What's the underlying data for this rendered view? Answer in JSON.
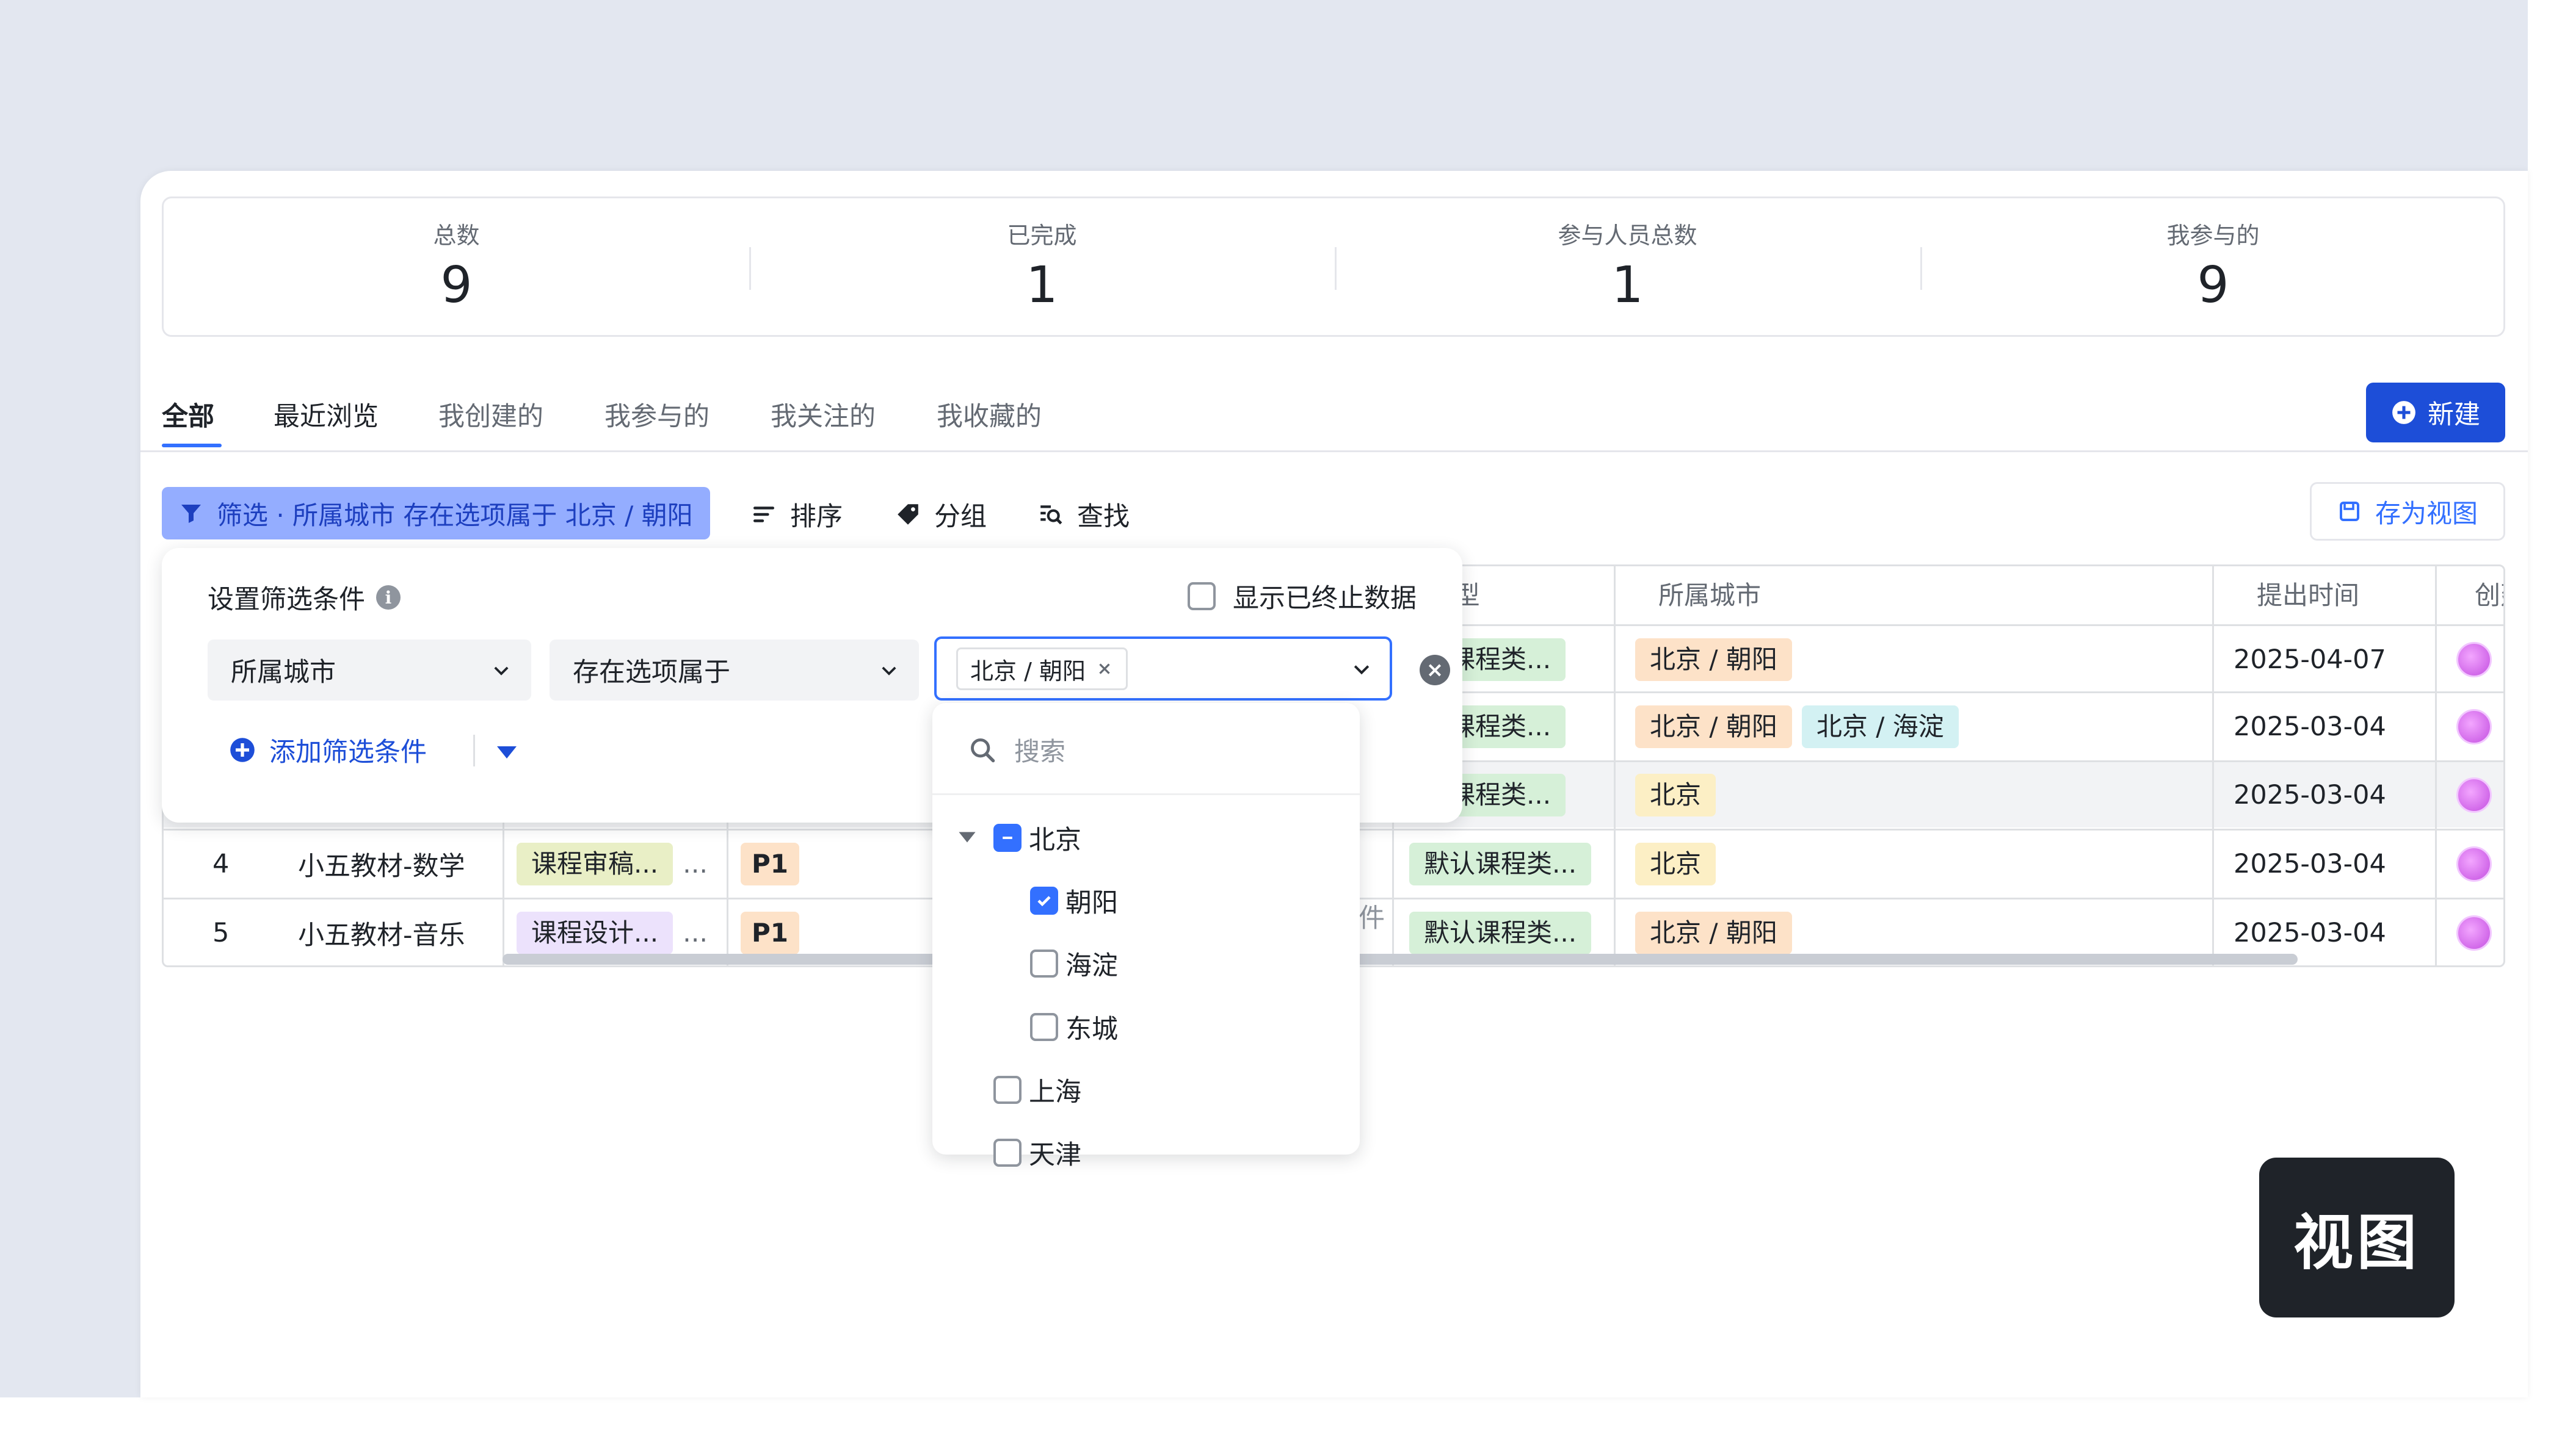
{
  "stats": [
    {
      "label": "总数",
      "value": "9"
    },
    {
      "label": "已完成",
      "value": "1"
    },
    {
      "label": "参与人员总数",
      "value": "1"
    },
    {
      "label": "我参与的",
      "value": "9"
    }
  ],
  "tabs": [
    {
      "label": "全部"
    },
    {
      "label": "最近浏览"
    },
    {
      "label": "我创建的"
    },
    {
      "label": "我参与的"
    },
    {
      "label": "我关注的"
    },
    {
      "label": "我收藏的"
    }
  ],
  "new_button": "新建",
  "toolbar": {
    "filter_chip": "筛选 · 所属城市 存在选项属于 北京 / 朝阳",
    "sort": "排序",
    "group": "分组",
    "find": "查找",
    "save_view": "存为视图"
  },
  "table": {
    "headers": {
      "type": "l类型",
      "city": "所属城市",
      "date": "提出时间",
      "creator": "创建"
    },
    "rows": [
      {
        "num": "",
        "name": "",
        "stage": "",
        "priority": "",
        "type": "人课程类...",
        "cities": [
          "北京 / 朝阳"
        ],
        "date": "2025-04-07"
      },
      {
        "num": "",
        "name": "",
        "stage": "",
        "priority": "",
        "type": "人课程类...",
        "cities": [
          "北京 / 朝阳",
          "北京 / 海淀"
        ],
        "date": "2025-03-04"
      },
      {
        "num": "",
        "name": "",
        "stage": "",
        "priority": "",
        "type": "人课程类...",
        "cities": [
          "北京"
        ],
        "date": "2025-03-04"
      },
      {
        "num": "4",
        "name": "小五教材-数学",
        "stage": "课程审稿...",
        "priority": "P1",
        "type": "默认课程类...",
        "cities": [
          "北京"
        ],
        "date": "2025-03-04"
      },
      {
        "num": "5",
        "name": "小五教材-音乐",
        "stage": "课程设计...",
        "priority": "P1",
        "type": "默认课程类...",
        "cities": [
          "北京 / 朝阳"
        ],
        "date": "2025-03-04"
      }
    ],
    "ellipsis": "..."
  },
  "filter_panel": {
    "title": "设置筛选条件",
    "show_ended": "显示已终止数据",
    "field": "所属城市",
    "operator": "存在选项属于",
    "selected_tag": "北京 / 朝阳",
    "add_condition": "添加筛选条件",
    "behind_text": "件"
  },
  "dropdown": {
    "search_placeholder": "搜索",
    "options": [
      {
        "label": "北京",
        "state": "indeterminate"
      },
      {
        "label": "朝阳",
        "state": "checked"
      },
      {
        "label": "海淀",
        "state": "unchecked"
      },
      {
        "label": "东城",
        "state": "unchecked"
      },
      {
        "label": "上海",
        "state": "unchecked"
      },
      {
        "label": "天津",
        "state": "unchecked"
      }
    ]
  },
  "view_badge": "视图",
  "colors": {
    "accent": "#3370ff",
    "primary_button": "#1d4ed8",
    "filter_chip_bg": "#94adff",
    "badge_bg": "#1f2329"
  }
}
